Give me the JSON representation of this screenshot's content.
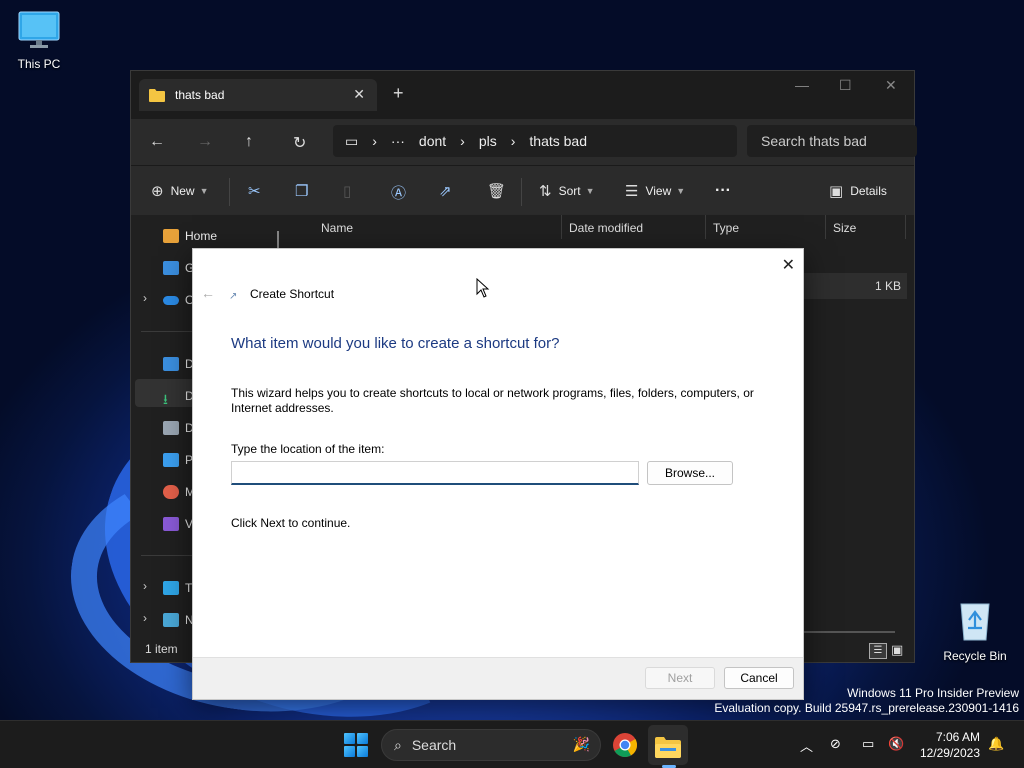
{
  "desktop": {
    "this_pc_label": "This PC",
    "recycle_bin_label": "Recycle Bin"
  },
  "explorer": {
    "tab_title": "thats bad",
    "address": {
      "ellipsis": "···",
      "crumbs": [
        "dont",
        "pls",
        "thats bad"
      ],
      "separator": "›"
    },
    "search_placeholder": "Search thats bad",
    "toolbar": {
      "new_label": "New",
      "sort_label": "Sort",
      "view_label": "View",
      "more_label": "···",
      "details_label": "Details"
    },
    "columns": [
      "Name",
      "Date modified",
      "Type",
      "Size"
    ],
    "sidebar": {
      "home_label": "Home",
      "items": [
        "G",
        "O",
        "D",
        "D",
        "D",
        "P",
        "M",
        "V",
        "T",
        "N"
      ]
    },
    "file_size": "1 KB",
    "status": "1 item"
  },
  "dialog": {
    "title": "Create Shortcut",
    "heading": "What item would you like to create a shortcut for?",
    "description": "This wizard helps you to create shortcuts to local or network programs, files, folders, computers, or Internet addresses.",
    "location_label": "Type the location of the item:",
    "location_value": "",
    "browse_label": "Browse...",
    "continue_text": "Click Next to continue.",
    "next_label": "Next",
    "cancel_label": "Cancel"
  },
  "watermark": {
    "line1": "Windows 11 Pro Insider Preview",
    "line2": "Evaluation copy. Build 25947.rs_prerelease.230901-1416"
  },
  "taskbar": {
    "search_label": "Search",
    "time": "7:06 AM",
    "date": "12/29/2023"
  },
  "colors": {
    "accent": "#1c3a82",
    "input_focus": "#1f4d7a",
    "folder_yellow": "#f4c542"
  }
}
